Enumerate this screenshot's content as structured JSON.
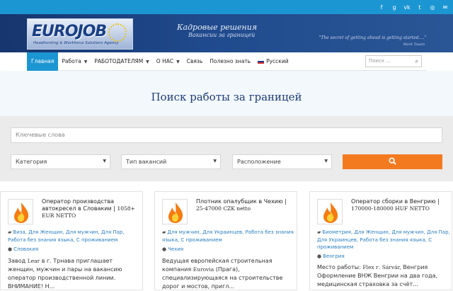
{
  "topbar": {
    "social": [
      {
        "name": "facebook-icon",
        "glyph": "f"
      },
      {
        "name": "google-plus-icon",
        "glyph": "g"
      },
      {
        "name": "vk-icon",
        "glyph": "vk"
      },
      {
        "name": "twitter-icon",
        "glyph": "t"
      },
      {
        "name": "instagram-icon",
        "glyph": "◎"
      },
      {
        "name": "email-icon",
        "glyph": "✉"
      }
    ]
  },
  "header": {
    "logo_text": "EUROJOB",
    "logo_sub": "Headhunting & Workforce Solutions Agency",
    "title": "Кадровые решения",
    "subtitle": "Вакансии за границей",
    "quote": "\"The secret of getting ahead is getting started....\"",
    "quote_author": "Mark Twain"
  },
  "nav": {
    "items": [
      {
        "label": "Главная",
        "caret": false
      },
      {
        "label": "Работа",
        "caret": true
      },
      {
        "label": "РАБОТОДАТЕЛЯМ",
        "caret": true
      },
      {
        "label": "О НАС",
        "caret": true
      },
      {
        "label": "Связь",
        "caret": false
      },
      {
        "label": "Полезно знать",
        "caret": false
      },
      {
        "label": "Русский",
        "caret": false
      }
    ],
    "search_placeholder": "Поиск ..."
  },
  "hero": {
    "title": "Поиск работы за границей"
  },
  "search": {
    "keywords_placeholder": "Ключевые слова",
    "category": "Категория",
    "type": "Тип вакансий",
    "location": "Расположение"
  },
  "cards": [
    {
      "title_ru": "Оператор производства автокресел в Словакии | ",
      "title_num": "1058+ EUR NETTO",
      "tags": "Виза, Для Женщин, Для мужчин, Для Пар, Работа без знания языка, С проживанием",
      "location": "Словакия",
      "desc_a": "Завод ",
      "desc_b": "Lear",
      "desc_c": " в г. Трнава приглашает женщин, мужчин и пары на вакансию оператор производственной линии. ВНИМАНИЕ! Н..."
    },
    {
      "title_ru": "Плотник опалубщик в Чехию | ",
      "title_num": "25-47000 CZK netto",
      "tags": "Для мужчин, Для Украинцев, Работа без знания языка, С проживанием",
      "location": "Чехия",
      "desc_a": "Ведущая европейская строительная компания ",
      "desc_b": "Eurovia",
      "desc_c": " (Прага), специализирующаяся на строительстве дорог и мостов, пригл..."
    },
    {
      "title_ru": "Оператор сборки в Венгрию | ",
      "title_num": "170000-180000 HUF NETTO",
      "tags": "Биометрия, Для Женщин, Для мужчин, Для Пар, Для Украинцев, Работа без знания языка, С проживанием",
      "location": "Венгрия",
      "desc_a": "Место работы: ",
      "desc_b": "Flex  г. Sárvár,",
      "desc_c": " Венгрия Оформление ВНЖ Венгрии на два года, медицинская страховка за счёт..."
    }
  ]
}
